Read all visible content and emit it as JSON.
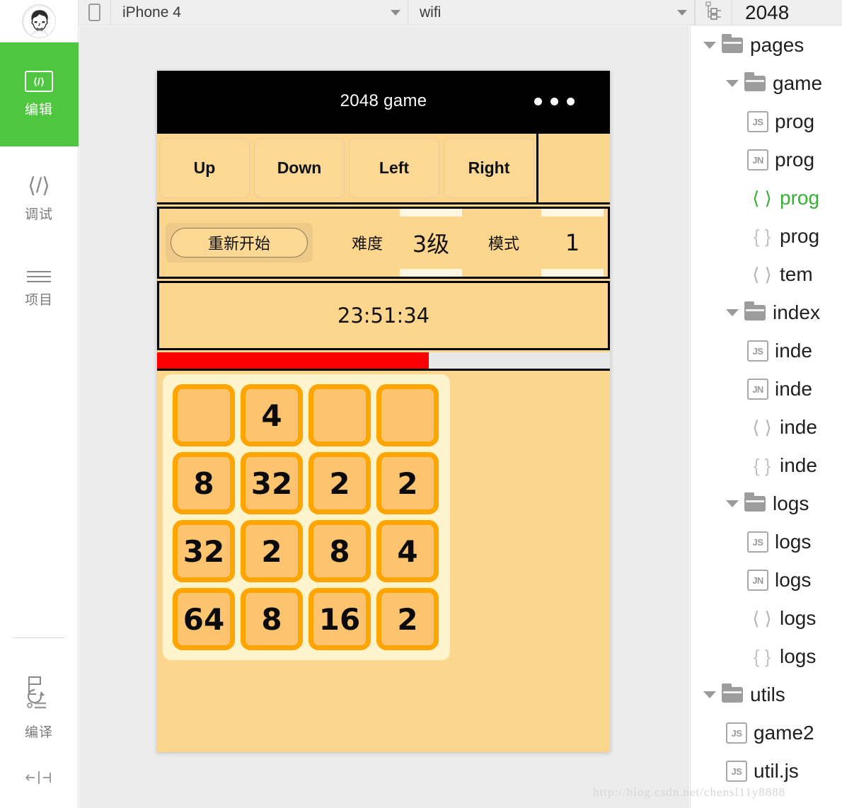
{
  "sidebar": {
    "avatar_alt": "user-avatar",
    "items": [
      {
        "icon": "code-brackets-icon",
        "label": "编辑",
        "active": true
      },
      {
        "icon": "angle-brackets-icon",
        "label": "调试",
        "active": false
      },
      {
        "icon": "hamburger-icon",
        "label": "项目",
        "active": false
      },
      {
        "icon": "compile-refresh-icon",
        "label": "编译",
        "active": false
      }
    ],
    "bottom_icon": "collapse-panel-icon"
  },
  "toolbar": {
    "device_icon": "device-phone-icon",
    "device_value": "iPhone 4",
    "network_value": "wifi",
    "tree_icon": "project-tree-icon",
    "project_title": "2048"
  },
  "simulator": {
    "header_title": "2048 game",
    "header_menu_icon": "three-dots-icon",
    "direction_buttons": [
      "Up",
      "Down",
      "Left",
      "Right"
    ],
    "restart_label": "重新开始",
    "difficulty_label": "难度",
    "difficulty_value": "3级",
    "mode_label": "模式",
    "mode_value": "1",
    "timer": "23:51:34",
    "progress_percent": 60,
    "progress_color": "#fc0000",
    "board": [
      [
        "",
        "4",
        "",
        ""
      ],
      [
        "8",
        "32",
        "2",
        "2"
      ],
      [
        "32",
        "2",
        "8",
        "4"
      ],
      [
        "64",
        "8",
        "16",
        "2"
      ]
    ]
  },
  "filetree": {
    "rows": [
      {
        "indent": 1,
        "kind": "folder",
        "label": "pages"
      },
      {
        "indent": 2,
        "kind": "folder",
        "label": "game"
      },
      {
        "indent": 3,
        "kind": "js",
        "label": "prog"
      },
      {
        "indent": 3,
        "kind": "jn",
        "label": "prog"
      },
      {
        "indent": 3,
        "kind": "angle",
        "label": "prog",
        "selected": true
      },
      {
        "indent": 3,
        "kind": "brace",
        "label": "prog"
      },
      {
        "indent": 3,
        "kind": "angle",
        "label": "tem"
      },
      {
        "indent": 2,
        "kind": "folder",
        "label": "index"
      },
      {
        "indent": 3,
        "kind": "js",
        "label": "inde"
      },
      {
        "indent": 3,
        "kind": "jn",
        "label": "inde"
      },
      {
        "indent": 3,
        "kind": "angle",
        "label": "inde"
      },
      {
        "indent": 3,
        "kind": "brace",
        "label": "inde"
      },
      {
        "indent": 2,
        "kind": "folder",
        "label": "logs"
      },
      {
        "indent": 3,
        "kind": "js",
        "label": "logs"
      },
      {
        "indent": 3,
        "kind": "jn",
        "label": "logs"
      },
      {
        "indent": 3,
        "kind": "angle",
        "label": "logs"
      },
      {
        "indent": 3,
        "kind": "brace",
        "label": "logs"
      },
      {
        "indent": 1,
        "kind": "folder",
        "label": "utils"
      },
      {
        "indent": 2,
        "kind": "js",
        "label": "game2"
      },
      {
        "indent": 2,
        "kind": "js",
        "label": "util.js"
      }
    ],
    "badge_js": "JS",
    "badge_jn": "JN",
    "angle_glyph": "⟨ ⟩",
    "brace_glyph": "{ }"
  },
  "watermark": "http://blog.csdn.net/chensl11y8888"
}
